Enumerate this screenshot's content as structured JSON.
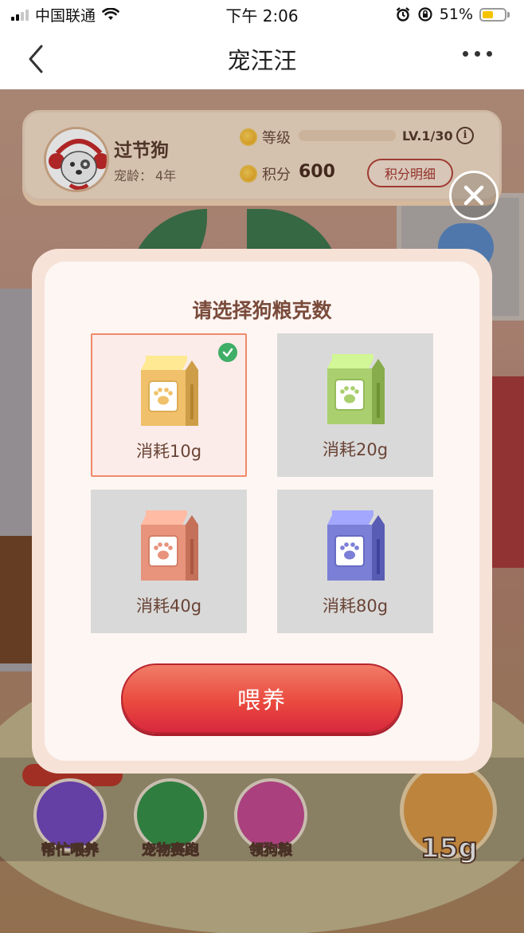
{
  "status_bar": {
    "carrier": "中国联通",
    "time": "下午 2:06",
    "battery": "51%",
    "battery_level": 0.51
  },
  "nav": {
    "title": "宠汪汪",
    "back_icon": "chevron-left-icon",
    "more_icon": "more-dots-icon"
  },
  "profile": {
    "name": "过节狗",
    "age_label": "宠龄：",
    "age_value": "4年",
    "level_label": "等级",
    "level_text": "LV.1/30",
    "level_progress": 0.0,
    "points_label": "积分",
    "points_value": "600",
    "points_button": "积分明细",
    "info_glyph": "i"
  },
  "dialog": {
    "title": "请选择狗粮克数",
    "options": [
      {
        "label": "消耗10g",
        "color": "#f0c16a",
        "selected": true
      },
      {
        "label": "消耗20g",
        "color": "#a9cf6e",
        "selected": false
      },
      {
        "label": "消耗40g",
        "color": "#e8937c",
        "selected": false
      },
      {
        "label": "消耗80g",
        "color": "#7b7fd6",
        "selected": false
      }
    ],
    "confirm_button": "喂养",
    "close_icon": "close-icon"
  },
  "bottom_bar": {
    "items": [
      {
        "label": "帮忙喂养"
      },
      {
        "label": "宠物赛跑"
      },
      {
        "label": "领狗粮"
      }
    ],
    "feed_amount": "15g"
  },
  "colors": {
    "accent": "#e8443a",
    "selected_border": "#f08a6a",
    "check": "#3fae66"
  }
}
